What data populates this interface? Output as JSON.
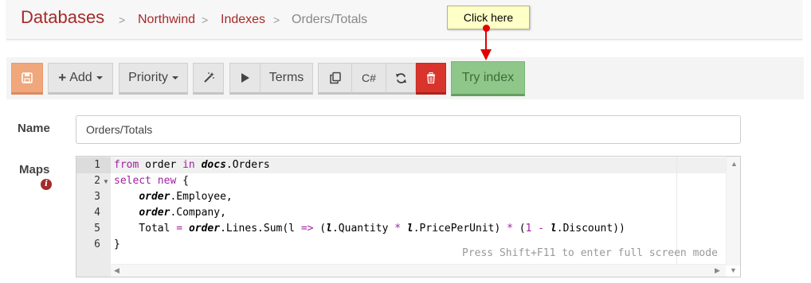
{
  "breadcrumb": {
    "title": "Databases",
    "sep": ">",
    "database": "Northwind",
    "section": "Indexes",
    "current": "Orders/Totals"
  },
  "tooltip": {
    "text": "Click here"
  },
  "toolbar": {
    "add_label": "Add",
    "priority_label": "Priority",
    "terms_label": "Terms",
    "csharp_label": "C#",
    "try_label": "Try index",
    "icons": [
      "save-icon",
      "plus-icon",
      "caret-down-icon",
      "magic-wand-icon",
      "play-icon",
      "copy-icon",
      "refresh-icon",
      "trash-icon"
    ],
    "colors": {
      "save": "#f0a77c",
      "delete": "#d9342b",
      "try": "#8fc68a"
    }
  },
  "form": {
    "name_label": "Name",
    "name_value": "Orders/Totals",
    "maps_label": "Maps"
  },
  "editor": {
    "line_numbers": [
      "1",
      "2",
      "3",
      "4",
      "5",
      "6"
    ],
    "hint": "Press Shift+F11 to enter full screen mode"
  }
}
